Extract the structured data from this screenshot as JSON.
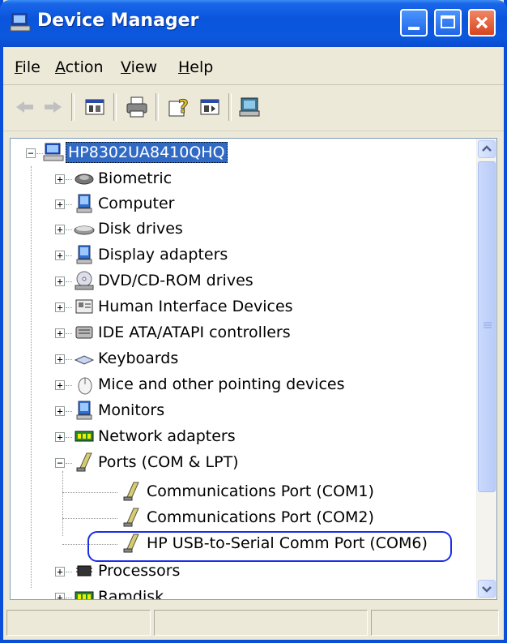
{
  "window": {
    "title": "Device Manager"
  },
  "menu": [
    {
      "label": "File",
      "accel": "F",
      "rest": "ile"
    },
    {
      "label": "Action",
      "accel": "A",
      "rest": "ction"
    },
    {
      "label": "View",
      "accel": "V",
      "rest": "iew"
    },
    {
      "label": "Help",
      "accel": "H",
      "rest": "elp"
    }
  ],
  "toolbar": {
    "buttons": [
      "back-icon",
      "forward-icon",
      "properties-view-icon",
      "print-icon",
      "help-icon",
      "show-hide-tree-icon",
      "scan-hardware-icon"
    ]
  },
  "tree": {
    "root": "HP8302UA8410QHQ",
    "categories": [
      "Biometric",
      "Computer",
      "Disk drives",
      "Display adapters",
      "DVD/CD-ROM drives",
      "Human Interface Devices",
      "IDE ATA/ATAPI controllers",
      "Keyboards",
      "Mice and other pointing devices",
      "Monitors",
      "Network adapters",
      "Ports (COM & LPT)"
    ],
    "ports": [
      "Communications Port (COM1)",
      "Communications Port (COM2)",
      "HP USB-to-Serial Comm Port (COM6)"
    ],
    "after": [
      "Processors",
      "Ramdisk"
    ]
  },
  "colors": {
    "title_bar": "#0a55dc",
    "selection": "#316ac5",
    "highlight_ring": "#1b2ee8"
  }
}
